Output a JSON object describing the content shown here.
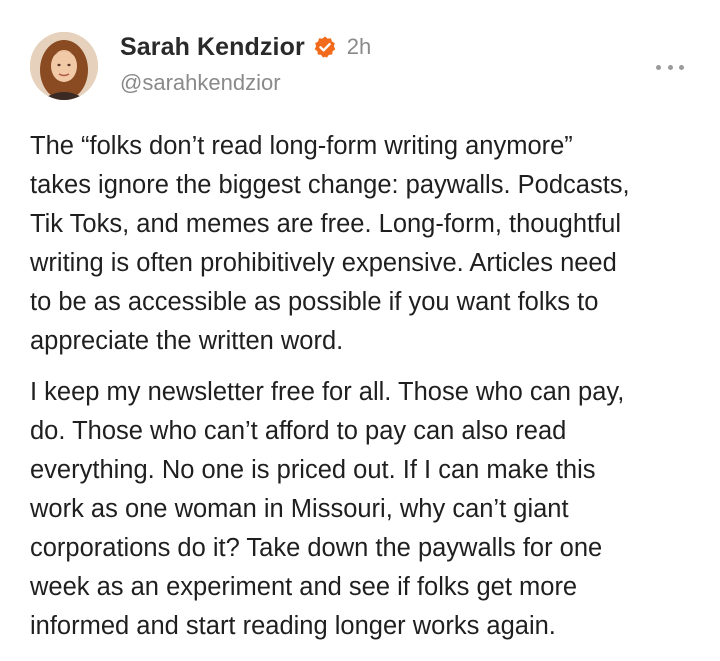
{
  "post": {
    "author": {
      "display_name": "Sarah Kendzior",
      "handle": "@sarahkendzior",
      "verified": true,
      "avatar_icon": "profile-photo"
    },
    "timestamp": "2h",
    "more_icon": "ellipsis-icon",
    "paragraphs": [
      "The “folks don’t read long-form writing anymore”\ntakes ignore the biggest change: paywalls. Podcasts,\nTik Toks, and memes are free. Long-form, thoughtful\nwriting is often prohibitively expensive. Articles need\nto be as accessible as possible if you want folks to\nappreciate the written word.",
      "I keep my newsletter free for all. Those who can pay,\ndo. Those who can’t afford to pay can also read\neverything. No one is priced out. If I can make this\nwork as one woman in Missouri, why can’t giant\ncorporations do it? Take down the paywalls for one\nweek as an experiment and see if folks get more\ninformed and start reading longer works again."
    ]
  },
  "colors": {
    "verified_badge": "#f26b1d",
    "secondary_text": "#8a8a8a",
    "primary_text": "#1f1f1f"
  }
}
